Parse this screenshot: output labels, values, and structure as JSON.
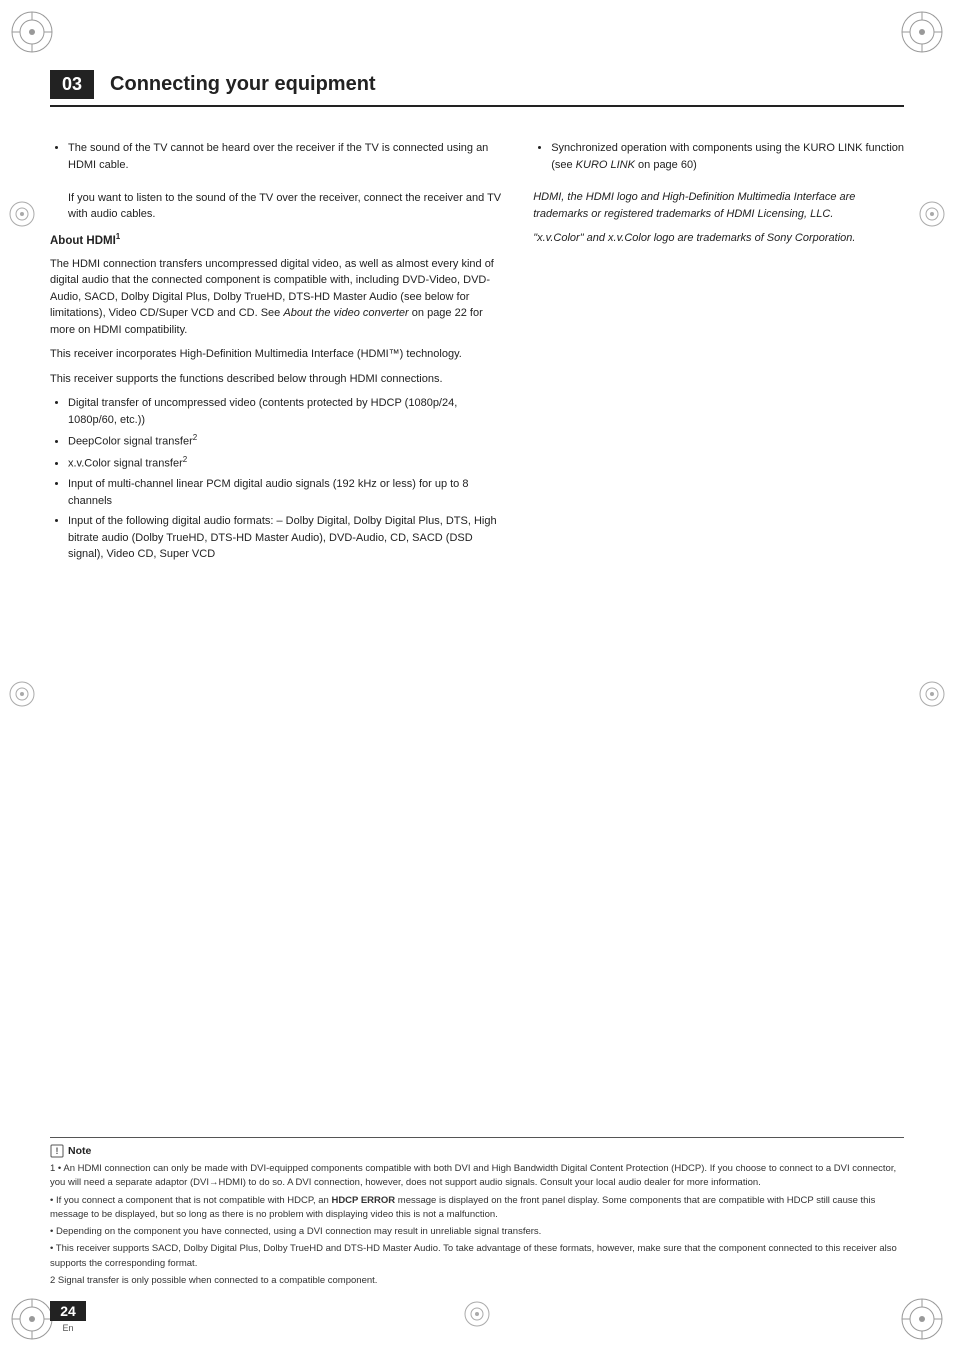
{
  "header": {
    "chapter_number": "03",
    "chapter_title": "Connecting your equipment"
  },
  "page": {
    "number": "24",
    "lang": "En"
  },
  "left_column": {
    "bullet1": "The sound of the TV cannot be heard over the receiver if the TV is connected using an HDMI cable.",
    "bullet1_cont": "If you want to listen to the sound of the TV over the receiver, connect the receiver and TV with audio cables.",
    "about_hdmi_heading": "About HDMI",
    "about_hdmi_sup": "1",
    "para1": "The HDMI connection transfers uncompressed digital video, as well as almost every kind of digital audio that the connected component is compatible with, including DVD-Video, DVD-Audio, SACD, Dolby Digital Plus, Dolby TrueHD, DTS-HD Master Audio (see below for limitations), Video CD/Super VCD and CD. See",
    "para1_italic": "About the video converter",
    "para1_cont": "on page 22 for more on HDMI compatibility.",
    "para2": "This receiver incorporates High-Definition Multimedia Interface (HDMI™) technology.",
    "para3": "This receiver supports the functions described below through HDMI connections.",
    "bullets": [
      "Digital transfer of uncompressed video (contents protected by HDCP (1080p/24, 1080p/60, etc.))",
      "DeepColor signal transfer²",
      "x.v.Color signal transfer²",
      "Input of multi-channel linear PCM digital audio signals (192 kHz or less) for up to 8 channels",
      "Input of the following digital audio formats: – Dolby Digital, Dolby Digital Plus, DTS, High bitrate audio (Dolby TrueHD, DTS-HD Master Audio), DVD-Audio, CD, SACD (DSD signal), Video CD, Super VCD"
    ]
  },
  "right_column": {
    "bullet1": "Synchronized operation with components using the KURO LINK function (see",
    "bullet1_italic": "KURO LINK",
    "bullet1_cont": "on page 60)",
    "para1": "HDMI, the HDMI logo and High-Definition Multimedia Interface are trademarks or registered trademarks of HDMI Licensing, LLC.",
    "para2": "\"x.v.Color\" and x.v.Color logo are trademarks of Sony Corporation."
  },
  "note": {
    "label": "Note",
    "items": [
      "1  • An HDMI connection can only be made with DVI-equipped components compatible with both DVI and High Bandwidth Digital Content Protection (HDCP). If you choose to connect to a DVI connector, you will need a separate adaptor (DVI→HDMI) to do so. A DVI connection, however, does not support audio signals. Consult your local audio dealer for more information.",
      "• If you connect a component that is not compatible with HDCP, an HDCP ERROR message is displayed on the front panel display. Some components that are compatible with HDCP still cause this message to be displayed, but so long as there is no problem with displaying video this is not a malfunction.",
      "• Depending on the component you have connected, using a DVI connection may result in unreliable signal transfers.",
      "• This receiver supports SACD, Dolby Digital Plus, Dolby TrueHD and DTS-HD Master Audio. To take advantage of these formats, however, make sure that the component connected to this receiver also supports the corresponding format.",
      "2 Signal transfer is only possible when connected to a compatible component."
    ]
  }
}
